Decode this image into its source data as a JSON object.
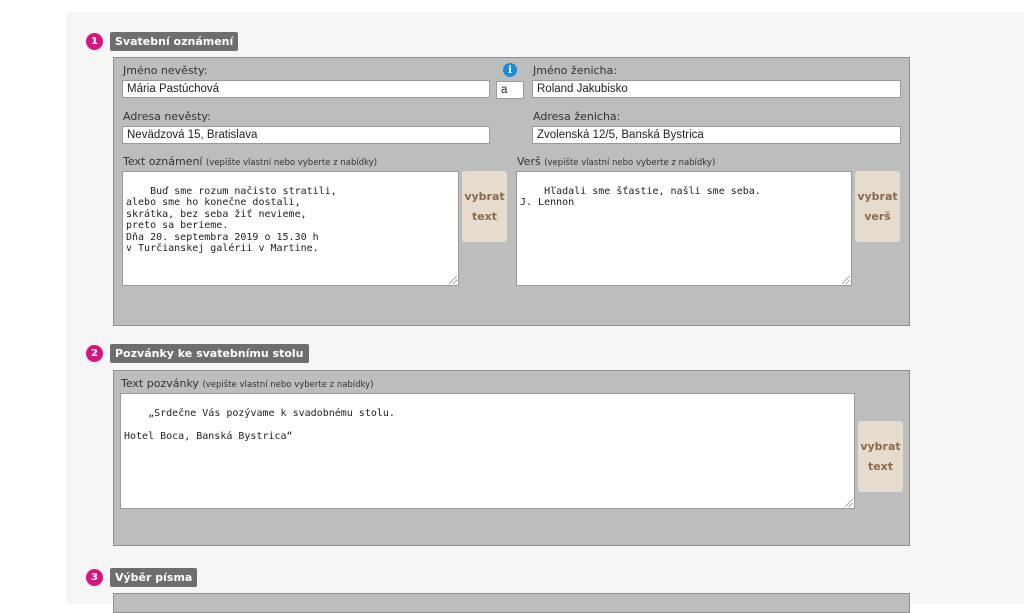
{
  "sections": [
    {
      "number": "1",
      "title": "Svatební oznámení"
    },
    {
      "number": "2",
      "title": "Pozvánky ke svatebnímu stolu"
    },
    {
      "number": "3",
      "title": "Výběr písma"
    }
  ],
  "announcement": {
    "bride_name_label": "Jméno nevěsty:",
    "bride_name_value": "Mária Pastúchová",
    "conjunction": "a",
    "groom_name_label": "Jméno ženicha:",
    "groom_name_value": "Roland Jakubisko",
    "bride_address_label": "Adresa nevěsty:",
    "bride_address_value": "Nevädzová 15, Bratislava",
    "groom_address_label": "Adresa ženicha:",
    "groom_address_value": "Zvolenská 12/5, Banská Bystrica",
    "text_label": "Text oznámení",
    "text_hint": "(vepište vlastní nebo vyberte z nabídky)",
    "text_value": "Buď sme rozum načisto stratili,\nalebo sme ho konečne dostali,\nskrátka, bez seba žiť nevieme,\npreto sa berieme.\nDňa 20. septembra 2019 o 15.30 h\nv Turčianskej galérii v Martine.",
    "pick_text_line1": "vybrat",
    "pick_text_line2": "text",
    "verse_label": "Verš",
    "verse_hint": "(vepište vlastní nebo vyberte z nabídky)",
    "verse_value": "Hľadali sme šťastie, našli sme seba.\nJ. Lennon",
    "pick_verse_line1": "vybrat",
    "pick_verse_line2": "verš"
  },
  "invitation": {
    "text_label": "Text pozvánky",
    "text_hint": "(vepište vlastní nebo vyberte z nabídky)",
    "text_value": "„Srdečne Vás pozývame k svadobnému stolu.\n\nHotel Boca, Banská Bystrica“",
    "pick_line1": "vybrat",
    "pick_line2": "text"
  },
  "icons": {
    "info": "info-icon",
    "resize": "resize-grip-icon"
  },
  "colors": {
    "accent": "#d6157f",
    "info": "#1a8bd6",
    "button_bg": "#e6dccd",
    "button_text": "#8a6a4d",
    "panel_bg": "#bdbdbd",
    "section_title_bg": "#6e6e6e"
  }
}
